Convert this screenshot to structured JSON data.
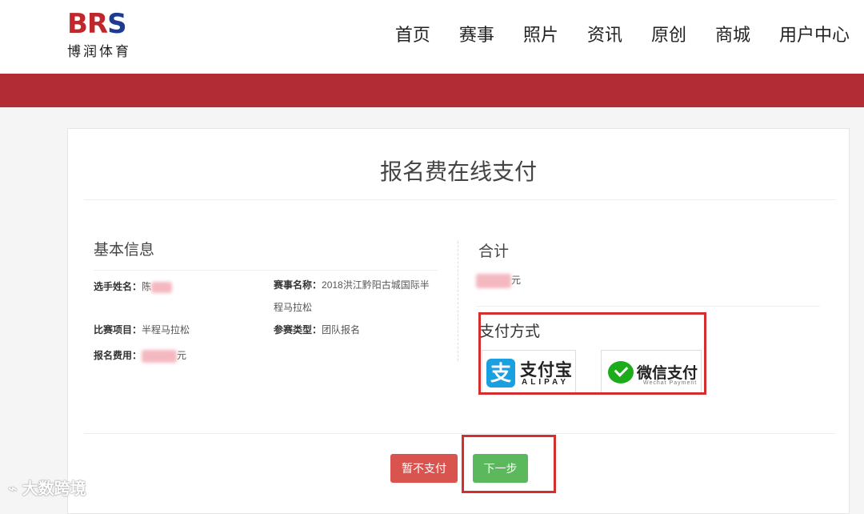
{
  "header": {
    "logo_text": "BRS",
    "logo_sub": "博润体育",
    "nav": [
      "首页",
      "赛事",
      "照片",
      "资讯",
      "原创",
      "商城",
      "用户中心"
    ]
  },
  "page": {
    "title": "报名费在线支付"
  },
  "basic_info": {
    "title": "基本信息",
    "player_name_label": "选手姓名：",
    "player_name_value": "陈",
    "event_name_label": "赛事名称：",
    "event_name_value_line1": "2018洪江黔阳古城国际半",
    "event_name_value_line2": "程马拉松",
    "item_label": "比赛项目：",
    "item_value": "半程马拉松",
    "type_label": "参赛类型：",
    "type_value": "团队报名",
    "fee_label": "报名费用：",
    "fee_unit": "元"
  },
  "summary": {
    "total_label": "合计",
    "total_unit": "元",
    "pay_method_label": "支付方式",
    "alipay_cn": "支付宝",
    "alipay_en": "ALIPAY",
    "alipay_icon": "支",
    "wechat_cn": "微信支付",
    "wechat_en": "Wechat Payment"
  },
  "actions": {
    "cancel": "暂不支付",
    "next": "下一步"
  },
  "watermark": "大数跨境",
  "colors": {
    "brand_red": "#b22c35",
    "cancel_red": "#d9534f",
    "next_green": "#5cb85c",
    "highlight": "#d42f2f"
  }
}
